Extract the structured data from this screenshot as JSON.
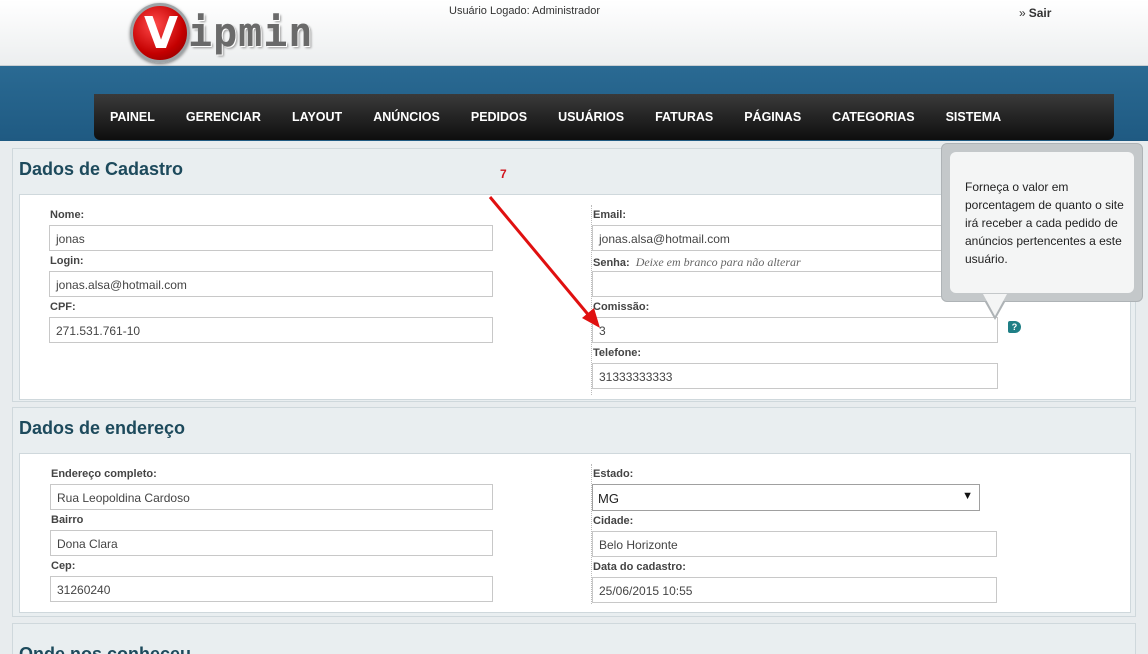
{
  "header": {
    "logo_letter": "V",
    "logo_text": "ipmin",
    "logged_user": "Usuário Logado: Administrador",
    "logout_prefix": "»",
    "logout_label": "Sair"
  },
  "nav": [
    "PAINEL",
    "GERENCIAR",
    "LAYOUT",
    "ANÚNCIOS",
    "PEDIDOS",
    "USUÁRIOS",
    "FATURAS",
    "PÁGINAS",
    "CATEGORIAS",
    "SISTEMA"
  ],
  "cadastro": {
    "title": "Dados de Cadastro",
    "nome_label": "Nome:",
    "nome_value": "jonas",
    "login_label": "Login:",
    "login_value": "jonas.alsa@hotmail.com",
    "cpf_label": "CPF:",
    "cpf_value": "271.531.761-10",
    "email_label": "Email:",
    "email_value": "jonas.alsa@hotmail.com",
    "senha_label": "Senha:",
    "senha_hint": "Deixe em branco para não alterar",
    "senha_value": "",
    "comissao_label": "Comissão:",
    "comissao_value": "3",
    "telefone_label": "Telefone:",
    "telefone_value": "31333333333"
  },
  "endereco": {
    "title": "Dados de endereço",
    "endereco_label": "Endereço completo:",
    "endereco_value": "Rua  Leopoldina Cardoso",
    "bairro_label": "Bairro",
    "bairro_value": "Dona Clara",
    "cep_label": "Cep:",
    "cep_value": "31260240",
    "estado_label": "Estado:",
    "estado_value": "MG",
    "cidade_label": "Cidade:",
    "cidade_value": "Belo Horizonte",
    "data_label": "Data do cadastro:",
    "data_value": "25/06/2015 10:55"
  },
  "third_panel": {
    "title": "Onde nos conheceu"
  },
  "annotation": {
    "number": "7",
    "color": "#d0141d"
  },
  "tooltip": {
    "text": "Forneça o valor em porcentagem de quanto o site irá receber a cada pedido de anúncios pertencentes a este usuário."
  },
  "help_icon_glyph": "?",
  "colors": {
    "nav_bg": "#111111",
    "bluebar": "#25618a",
    "title": "#1d4a5c",
    "arrow": "#e01010"
  }
}
